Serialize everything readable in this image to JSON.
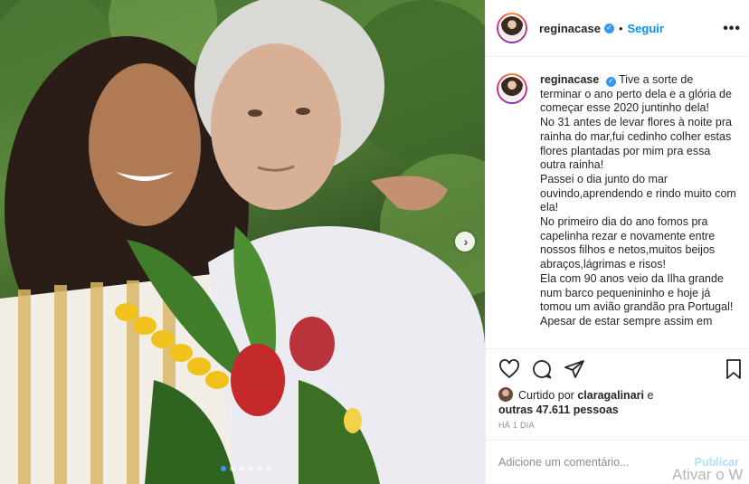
{
  "post": {
    "username": "reginacase",
    "follow_label": "Seguir",
    "separator": "•",
    "more_label": "•••",
    "verified_glyph": "✓",
    "caption": "Tive a sorte de terminar o ano perto dela e a glória de começar esse 2020 juntinho dela!\nNo 31 antes de levar flores à noite pra rainha do mar,fui cedinho colher estas flores plantadas por mim pra essa outra rainha!\nPassei o dia junto do mar ouvindo,aprendendo e rindo muito com ela!\nNo primeiro dia do ano fomos pra capelinha rezar e novamente entre nossos filhos e netos,muitos beijos abraços,lágrimas e risos!\nEla com 90 anos veio da Ilha grande num barco pequenininho e hoje já tomou um avião grandão pra Portugal!\nApesar de estar sempre assim em",
    "liked_by_prefix": "Curtido por",
    "liked_by_user": "claragalinari",
    "liked_by_middle": " e",
    "liked_by_others": "outras 47.611 pessoas",
    "time_ago": "HÁ 1 DIA",
    "comment_placeholder": "Adicione um comentário...",
    "publish_label": "Publicar"
  },
  "carousel": {
    "dot_count": 6,
    "active_index": 0,
    "next_glyph": "›"
  },
  "icons": [
    "heart-icon",
    "comment-icon",
    "share-icon",
    "bookmark-icon",
    "verified-icon",
    "more-options-icon",
    "chevron-right-icon"
  ],
  "colors": {
    "accent": "#0095f6",
    "verified": "#3897f0",
    "publish_disabled": "#b2dffc",
    "muted": "#8e8e8e"
  },
  "overlay": {
    "watermark": "Ativar o W"
  }
}
